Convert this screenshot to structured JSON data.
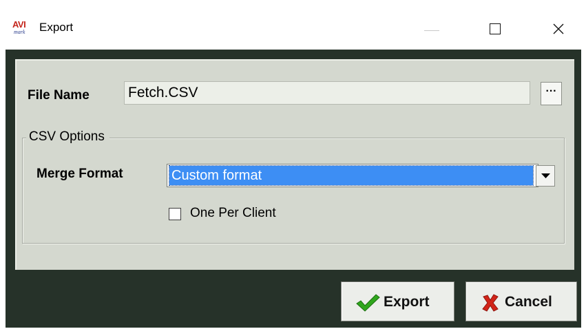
{
  "window": {
    "title": "Export",
    "app_icon": {
      "name": "avimark-icon",
      "line1": "AVI",
      "line2": "mark"
    },
    "controls": {
      "minimize": "minimize-icon",
      "maximize": "maximize-icon",
      "close": "close-icon"
    }
  },
  "file": {
    "label": "File Name",
    "value": "Fetch.CSV",
    "browse_label": "···"
  },
  "csv_options": {
    "legend": "CSV Options",
    "merge_format": {
      "label": "Merge Format",
      "selected": "Custom format"
    },
    "one_per_client": {
      "label": "One Per Client",
      "checked": false
    }
  },
  "buttons": {
    "export": {
      "label": "Export",
      "icon": "checkmark-icon"
    },
    "cancel": {
      "label": "Cancel",
      "icon": "x-icon"
    }
  },
  "colors": {
    "frame": "#263229",
    "client_bg": "#d4d8cf",
    "selection": "#3d8ef4",
    "check_green": "#2fa61c",
    "cancel_red": "#d22418"
  }
}
